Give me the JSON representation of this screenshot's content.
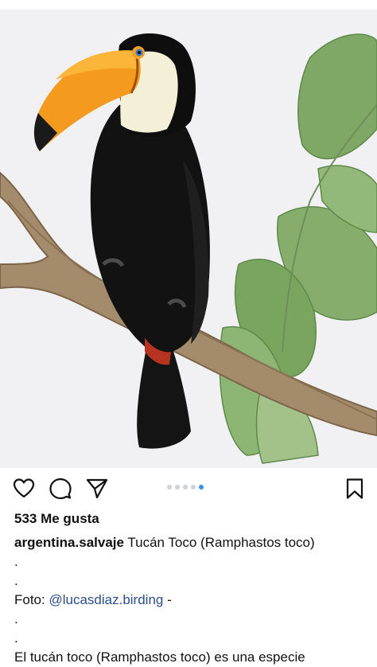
{
  "post": {
    "image_alt": "toucan-photo",
    "carousel": {
      "total": 5,
      "active_index": 4
    },
    "actions": {
      "like_icon": "heart-icon",
      "comment_icon": "comment-bubble-icon",
      "share_icon": "paper-plane-icon",
      "save_icon": "bookmark-icon"
    },
    "likes_text": "533 Me gusta",
    "caption": {
      "username": "argentina.salvaje",
      "title": "Tucán Toco (Ramphastos toco)",
      "dot1": ".",
      "dot2": ".",
      "photo_prefix": "Foto: ",
      "photo_mention": "@lucasdiaz.birding",
      "photo_suffix": " -",
      "dot3": ".",
      "dot4": ".",
      "last_line": "El tucán toco (Ramphastos toco) es una especie"
    }
  },
  "colors": {
    "accent_dot": "#3b8ff0",
    "inactive_dot": "#cfd3d8",
    "mention": "#2c4f8c"
  }
}
